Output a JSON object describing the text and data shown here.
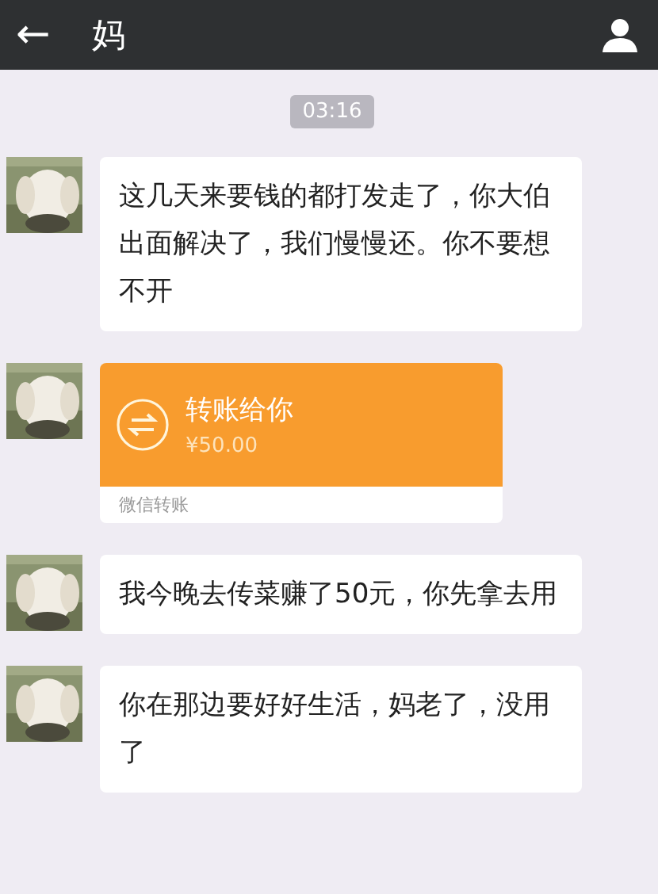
{
  "header": {
    "back_icon": "←",
    "title": "妈"
  },
  "time": "03:16",
  "messages": [
    {
      "kind": "text",
      "text": "这几天来要钱的都打发走了，你大伯出面解决了，我们慢慢还。你不要想不开"
    },
    {
      "kind": "transfer",
      "title": "转账给你",
      "amount": "¥50.00",
      "footer": "微信转账"
    },
    {
      "kind": "text",
      "text": "我今晚去传菜赚了50元，你先拿去用"
    },
    {
      "kind": "text",
      "text": "你在那边要好好生活，妈老了，没用了"
    }
  ]
}
